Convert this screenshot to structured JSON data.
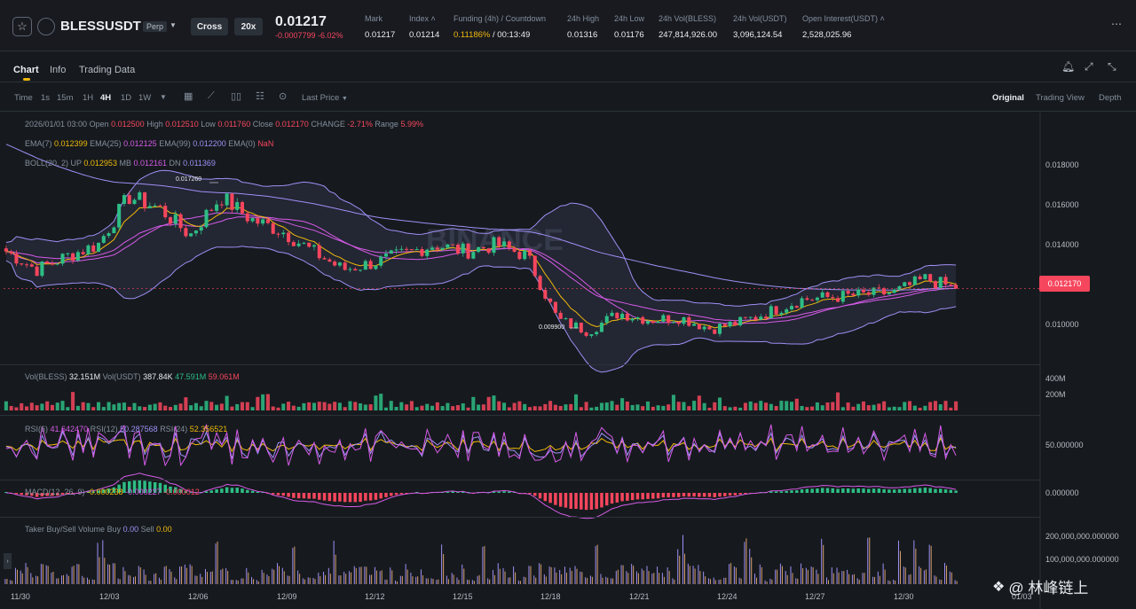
{
  "header": {
    "symbol": "BLESSUSDT",
    "perp_badge": "Perp",
    "margin_mode": "Cross",
    "leverage": "20x",
    "last_price": "0.01217",
    "change": "-0.0007799 -6.02%",
    "stats": [
      {
        "label": "Mark",
        "value": "0.01217"
      },
      {
        "label": "Index ˄",
        "value": "0.01214"
      },
      {
        "label": "Funding (4h) / Countdown",
        "value_rate": "0.11186%",
        "value_countdown": " / 00:13:49"
      },
      {
        "label": "24h High",
        "value": "0.01316"
      },
      {
        "label": "24h Low",
        "value": "0.01176"
      },
      {
        "label": "24h Vol(BLESS)",
        "value": "247,814,926.00"
      },
      {
        "label": "24h Vol(USDT)",
        "value": "3,096,124.54"
      },
      {
        "label": "Open Interest(USDT) ˄",
        "value": "2,528,025.96"
      }
    ]
  },
  "tabs": [
    "Chart",
    "Info",
    "Trading Data"
  ],
  "toolbar": {
    "intervals": [
      "Time",
      "1s",
      "15m",
      "1H",
      "4H",
      "1D",
      "1W"
    ],
    "active_interval": "4H",
    "price_type": "Last Price",
    "views": [
      "Original",
      "Trading View",
      "Depth"
    ],
    "active_view": "Original"
  },
  "ohlc": {
    "date": "2026/01/01 03:00",
    "open_label": "Open",
    "open": "0.012500",
    "high_label": "High",
    "high": "0.012510",
    "low_label": "Low",
    "low": "0.011760",
    "close_label": "Close",
    "close": "0.012170",
    "change_label": "CHANGE",
    "change": "-2.71%",
    "range_label": "Range",
    "range": "5.99%"
  },
  "ema": {
    "ema7_label": "EMA(7)",
    "ema7": "0.012399",
    "ema25_label": "EMA(25)",
    "ema25": "0.012125",
    "ema99_label": "EMA(99)",
    "ema99": "0.012200",
    "ema0_label": "EMA(0)",
    "ema0": "NaN"
  },
  "boll": {
    "label": "BOLL(20, 2)",
    "up_label": "UP",
    "up": "0.012953",
    "mb_label": "MB",
    "mb": "0.012161",
    "dn_label": "DN",
    "dn": "0.011369"
  },
  "price_axis": [
    "0.018000",
    "0.016000",
    "0.014000",
    "0.012000",
    "0.010000"
  ],
  "current_price_tag": "0.012170",
  "high_marker": "0.017260",
  "low_marker": "0.009900",
  "volume": {
    "label1": "Vol(BLESS)",
    "v1": "32.151M",
    "label2": "Vol(USDT)",
    "v2": "387.84K",
    "v3": "47.591M",
    "v4": "59.061M",
    "axis": [
      "400M",
      "200M"
    ]
  },
  "rsi": {
    "rsi6_label": "RSI(6)",
    "rsi6": "41.642470",
    "rsi12_label": "RSI(12)",
    "rsi12": "50.287568",
    "rsi24_label": "RSI(24)",
    "rsi24": "52.356521",
    "axis": "50.000000"
  },
  "macd": {
    "label": "MACD(12, 26, 9)",
    "v1": "-0.000238",
    "v2": "-0.000227",
    "v3": "-0.000012",
    "axis": "0.000000"
  },
  "taker": {
    "label": "Taker Buy/Sell Volume",
    "buy_label": "Buy",
    "buy": "0.00",
    "sell_label": "Sell",
    "sell": "0.00",
    "axis": [
      "200,000,000.000000",
      "100,000,000.000000"
    ]
  },
  "dates": [
    "11/30",
    "12/03",
    "12/06",
    "12/09",
    "12/12",
    "12/15",
    "12/18",
    "12/21",
    "12/24",
    "12/27",
    "12/30",
    "01/03"
  ],
  "watermark": "@ 林峰链上",
  "colors": {
    "up": "#2ebd85",
    "down": "#f6465d",
    "accent": "#f0b90b",
    "background": "#161a1e"
  },
  "chart_data": {
    "type": "candlestick",
    "interval": "4H",
    "approx_close_path": [
      {
        "date": "11/30",
        "close": 0.0138
      },
      {
        "date": "12/01",
        "close": 0.013
      },
      {
        "date": "12/02",
        "close": 0.0136
      },
      {
        "date": "12/03",
        "close": 0.0141
      },
      {
        "date": "12/04",
        "close": 0.0162
      },
      {
        "date": "12/05",
        "close": 0.0157
      },
      {
        "date": "12/06",
        "close": 0.0145
      },
      {
        "date": "12/07",
        "close": 0.0162
      },
      {
        "date": "12/08",
        "close": 0.0152
      },
      {
        "date": "12/09",
        "close": 0.0147
      },
      {
        "date": "12/10",
        "close": 0.0138
      },
      {
        "date": "12/11",
        "close": 0.013
      },
      {
        "date": "12/12",
        "close": 0.0133
      },
      {
        "date": "12/13",
        "close": 0.0137
      },
      {
        "date": "12/14",
        "close": 0.0141
      },
      {
        "date": "12/15",
        "close": 0.0138
      },
      {
        "date": "12/16",
        "close": 0.0141
      },
      {
        "date": "12/17",
        "close": 0.0136
      },
      {
        "date": "12/18",
        "close": 0.0108
      },
      {
        "date": "12/19",
        "close": 0.0103
      },
      {
        "date": "12/20",
        "close": 0.0111
      },
      {
        "date": "12/21",
        "close": 0.0108
      },
      {
        "date": "12/22",
        "close": 0.0109
      },
      {
        "date": "12/23",
        "close": 0.0104
      },
      {
        "date": "12/24",
        "close": 0.0107
      },
      {
        "date": "12/25",
        "close": 0.0112
      },
      {
        "date": "12/26",
        "close": 0.0117
      },
      {
        "date": "12/27",
        "close": 0.0118
      },
      {
        "date": "12/28",
        "close": 0.0119
      },
      {
        "date": "12/29",
        "close": 0.012
      },
      {
        "date": "12/30",
        "close": 0.0126
      },
      {
        "date": "01/01",
        "close": 0.01217
      }
    ],
    "y_range": [
      0.009,
      0.0195
    ],
    "high": 0.01726,
    "low": 0.0099
  }
}
